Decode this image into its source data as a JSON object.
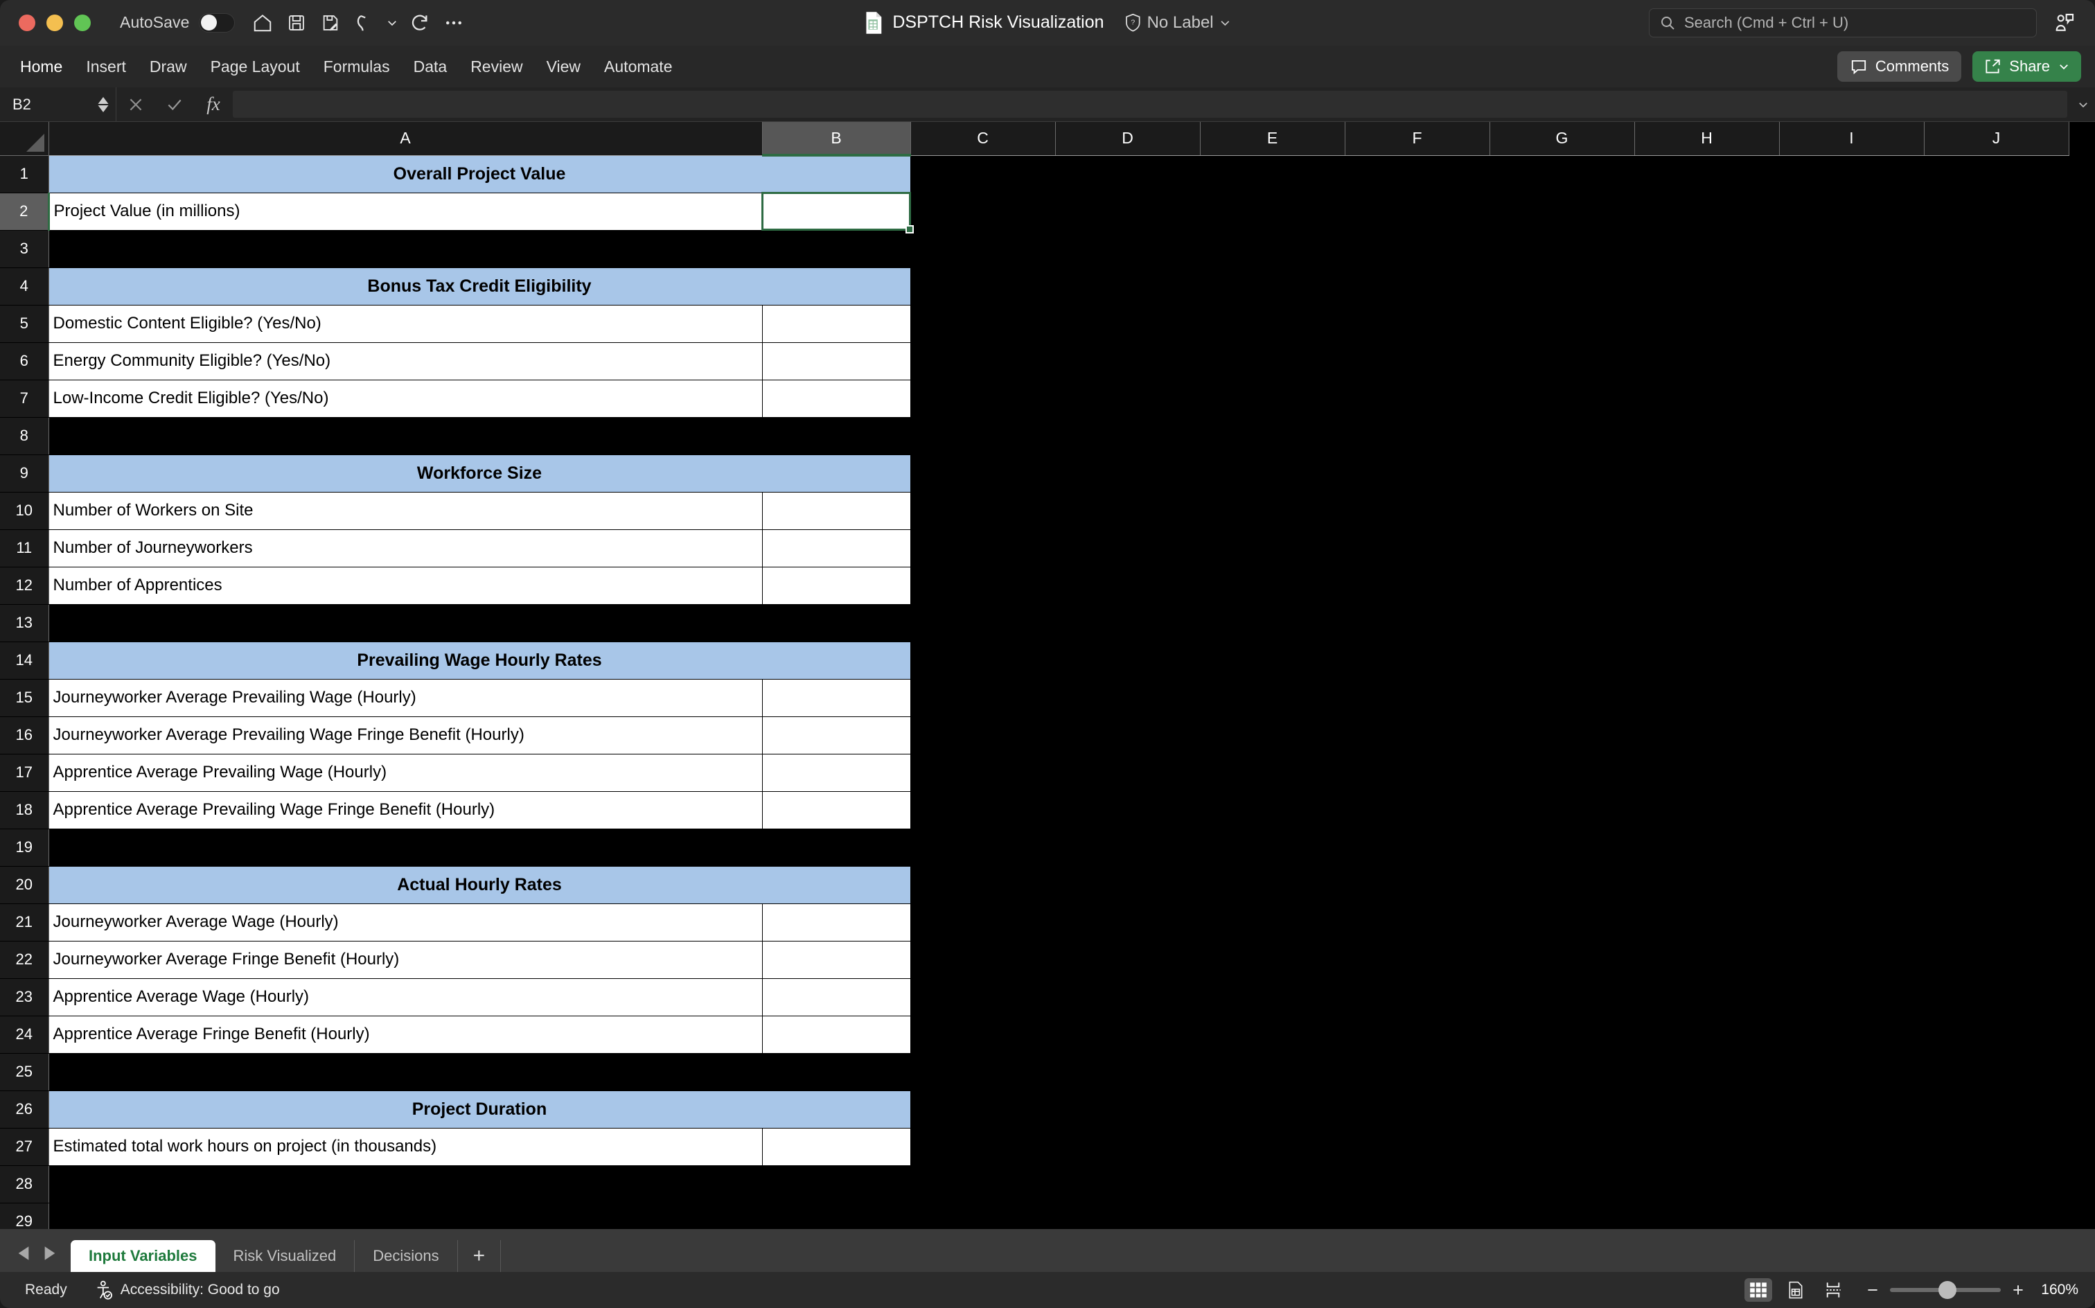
{
  "titlebar": {
    "autosave_label": "AutoSave",
    "autosave_state": "on",
    "document_title": "DSPTCH Risk Visualization",
    "label_text": "No Label",
    "search_placeholder": "Search (Cmd + Ctrl + U)",
    "quick_access": [
      "home-icon",
      "save-icon",
      "save-as-icon",
      "undo-icon",
      "undo-dropdown-icon",
      "redo-icon",
      "more-icon"
    ]
  },
  "ribbon": {
    "tabs": [
      {
        "label": "Home",
        "active": true
      },
      {
        "label": "Insert",
        "active": false
      },
      {
        "label": "Draw",
        "active": false
      },
      {
        "label": "Page Layout",
        "active": false
      },
      {
        "label": "Formulas",
        "active": false
      },
      {
        "label": "Data",
        "active": false
      },
      {
        "label": "Review",
        "active": false
      },
      {
        "label": "View",
        "active": false
      },
      {
        "label": "Automate",
        "active": false
      }
    ],
    "comments_label": "Comments",
    "share_label": "Share"
  },
  "formula_bar": {
    "name_box": "B2",
    "formula_value": "",
    "cancel_icon": "close-icon",
    "confirm_icon": "check-icon",
    "function_icon": "fx-icon"
  },
  "grid": {
    "columns": [
      "A",
      "B",
      "C",
      "D",
      "E",
      "F",
      "G",
      "H",
      "I",
      "J"
    ],
    "selected_column": "B",
    "selected_row": 2,
    "selected_cell": "B2",
    "header_fill": "#a8c6e8",
    "selection_color": "#2e6b43",
    "rows": [
      {
        "n": 1,
        "type": "section",
        "a": "Overall Project Value"
      },
      {
        "n": 2,
        "type": "entry",
        "a": "Project Value (in millions)",
        "b": ""
      },
      {
        "n": 3,
        "type": "blank",
        "a": "",
        "b": ""
      },
      {
        "n": 4,
        "type": "section",
        "a": "Bonus Tax Credit Eligibility"
      },
      {
        "n": 5,
        "type": "entry",
        "a": "Domestic Content Eligible? (Yes/No)",
        "b": ""
      },
      {
        "n": 6,
        "type": "entry",
        "a": "Energy Community Eligible? (Yes/No)",
        "b": ""
      },
      {
        "n": 7,
        "type": "entry",
        "a": "Low-Income Credit Eligible? (Yes/No)",
        "b": ""
      },
      {
        "n": 8,
        "type": "blank",
        "a": "",
        "b": ""
      },
      {
        "n": 9,
        "type": "section",
        "a": "Workforce Size"
      },
      {
        "n": 10,
        "type": "entry",
        "a": "Number of Workers on Site",
        "b": ""
      },
      {
        "n": 11,
        "type": "entry",
        "a": "Number of Journeyworkers",
        "b": ""
      },
      {
        "n": 12,
        "type": "entry",
        "a": "Number of Apprentices",
        "b": ""
      },
      {
        "n": 13,
        "type": "blank",
        "a": "",
        "b": ""
      },
      {
        "n": 14,
        "type": "section",
        "a": "Prevailing Wage Hourly Rates"
      },
      {
        "n": 15,
        "type": "entry",
        "a": "Journeyworker Average Prevailing Wage (Hourly)",
        "b": ""
      },
      {
        "n": 16,
        "type": "entry",
        "a": "Journeyworker Average Prevailing Wage Fringe Benefit (Hourly)",
        "b": ""
      },
      {
        "n": 17,
        "type": "entry",
        "a": "Apprentice Average Prevailing Wage (Hourly)",
        "b": ""
      },
      {
        "n": 18,
        "type": "entry",
        "a": "Apprentice Average Prevailing Wage Fringe Benefit (Hourly)",
        "b": ""
      },
      {
        "n": 19,
        "type": "blank",
        "a": "",
        "b": ""
      },
      {
        "n": 20,
        "type": "section",
        "a": "Actual Hourly Rates"
      },
      {
        "n": 21,
        "type": "entry",
        "a": "Journeyworker Average Wage (Hourly)",
        "b": ""
      },
      {
        "n": 22,
        "type": "entry",
        "a": "Journeyworker Average Fringe Benefit (Hourly)",
        "b": ""
      },
      {
        "n": 23,
        "type": "entry",
        "a": "Apprentice Average Wage (Hourly)",
        "b": ""
      },
      {
        "n": 24,
        "type": "entry",
        "a": "Apprentice Average Fringe Benefit (Hourly)",
        "b": ""
      },
      {
        "n": 25,
        "type": "blank",
        "a": "",
        "b": ""
      },
      {
        "n": 26,
        "type": "section",
        "a": "Project Duration"
      },
      {
        "n": 27,
        "type": "entry",
        "a": "Estimated total work hours on project (in thousands)",
        "b": ""
      },
      {
        "n": 28,
        "type": "blank",
        "a": "",
        "b": ""
      },
      {
        "n": 29,
        "type": "blank",
        "a": "",
        "b": ""
      }
    ]
  },
  "sheet_tabs": {
    "tabs": [
      {
        "label": "Input Variables",
        "active": true
      },
      {
        "label": "Risk Visualized",
        "active": false
      },
      {
        "label": "Decisions",
        "active": false
      }
    ],
    "add_label": "+"
  },
  "status_bar": {
    "ready_text": "Ready",
    "accessibility_text": "Accessibility: Good to go",
    "zoom_level": "160%",
    "zoom_minus": "−",
    "zoom_plus": "+",
    "view_buttons": [
      "normal-view-icon",
      "page-layout-icon",
      "page-break-icon"
    ]
  }
}
